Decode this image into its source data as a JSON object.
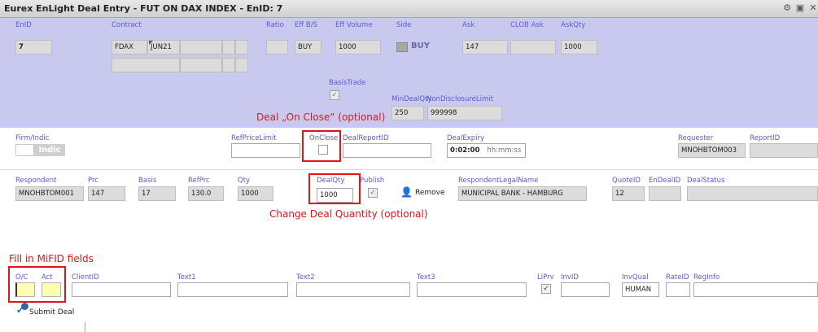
{
  "window": {
    "title": "Eurex EnLight Deal Entry - FUT ON DAX INDEX - EnID: 7"
  },
  "top": {
    "enid_label": "EnID",
    "enid_value": "7",
    "contract_label": "Contract",
    "contract_product": "FDAX",
    "contract_expiry": "JUN21",
    "ratio_label": "Ratio",
    "effbs_label": "Eff B/S",
    "effbs_value": "BUY",
    "effvol_label": "Eff Volume",
    "effvol_value": "1000",
    "side_label": "Side",
    "side_value": "BUY",
    "ask_label": "Ask",
    "ask_value": "147",
    "clobask_label": "CLOB Ask",
    "askqty_label": "AskQty",
    "askqty_value": "1000",
    "basistrade_label": "BasisTrade",
    "mindealqty_label": "MinDealQty",
    "mindealqty_value": "250",
    "nondisclosure_label": "NonDisclosureLimit",
    "nondisclosure_value": "999998"
  },
  "middle": {
    "firm_label": "Firm/Indic",
    "indic_value": "Indic",
    "refpricelimit_label": "RefPriceLimit",
    "onclose_label": "OnClose",
    "dealreportid_label": "DealReportID",
    "dealexpiry_label": "DealExpiry",
    "dealexpiry_value": "0:02:00",
    "dealexpiry_format": "hh:mm:ss",
    "requester_label": "Requester",
    "requester_value": "MNOHBTOM003",
    "reportid_label": "ReportID"
  },
  "respondent_row": {
    "respondent_label": "Respondent",
    "respondent_value": "MNOHBTOM001",
    "prc_label": "Prc",
    "prc_value": "147",
    "basis_label": "Basis",
    "basis_value": "17",
    "refprc_label": "RefPrc",
    "refprc_value": "130.0",
    "qty_label": "Qty",
    "qty_value": "1000",
    "dealqty_label": "DealQty",
    "dealqty_value": "1000",
    "publish_label": "Publish",
    "remove_label": "Remove",
    "legalname_label": "RespondentLegalName",
    "legalname_value": "MUNICIPAL BANK - HAMBURG",
    "quoteid_label": "QuoteID",
    "quoteid_value": "12",
    "endealid_label": "EnDealID",
    "dealstatus_label": "DealStatus"
  },
  "mifid": {
    "oc_label": "O/C",
    "act_label": "Act",
    "clientid_label": "ClientID",
    "text1_label": "Text1",
    "text2_label": "Text2",
    "text3_label": "Text3",
    "liprv_label": "LiPrv",
    "invid_label": "InvID",
    "invqual_label": "InvQual",
    "invqual_value": "HUMAN",
    "rateid_label": "RateID",
    "reginfo_label": "RegInfo",
    "submit_label": "Submit Deal"
  },
  "annotations": {
    "onclose": "Deal „On Close“ (optional)",
    "dealqty": "Change Deal Quantity (optional)",
    "mifid": "Fill in MiFID fields"
  },
  "colors": {
    "annotation_red": "#e01515",
    "top_band": "#c9c9ef",
    "label_blue": "#5a5ad0"
  },
  "icons": [
    "gear-icon",
    "window-icon",
    "close-icon",
    "person-icon",
    "submit-icon",
    "check-icon"
  ]
}
